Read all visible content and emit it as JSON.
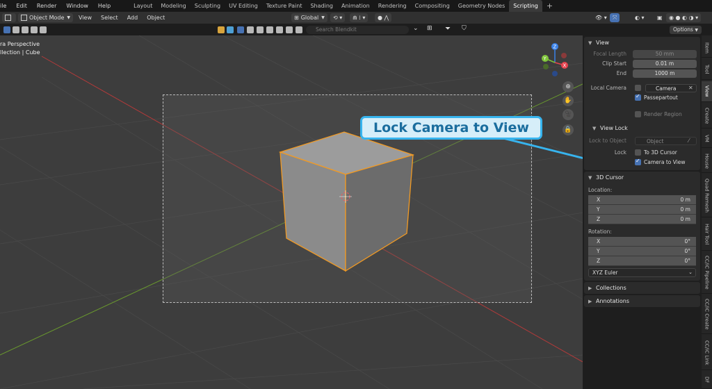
{
  "topbar": {
    "menus": [
      "ile",
      "Edit",
      "Render",
      "Window",
      "Help"
    ],
    "workspaces": [
      "Layout",
      "Modeling",
      "Sculpting",
      "UV Editing",
      "Texture Paint",
      "Shading",
      "Animation",
      "Rendering",
      "Compositing",
      "Geometry Nodes",
      "Scripting"
    ],
    "active_workspace": "Scripting",
    "add_symbol": "+"
  },
  "header": {
    "mode": "Object Mode",
    "menus": [
      "View",
      "Select",
      "Add",
      "Object"
    ],
    "transform_orientation": "Global",
    "options_label": "Options"
  },
  "toolbar": {
    "search_placeholder": "Search Blendkit"
  },
  "viewport": {
    "perspective_label": "ra Perspective",
    "collection_label": "llection | Cube",
    "gizmo": {
      "z": "Z",
      "y": "Y",
      "x": "X"
    },
    "callout_text": "Lock Camera to View"
  },
  "npanel": {
    "view_section": "View",
    "focal_length_label": "Focal Length",
    "focal_length_value": "50 mm",
    "clip_start_label": "Clip Start",
    "clip_start_value": "0.01 m",
    "end_label": "End",
    "end_value": "1000 m",
    "local_camera_label": "Local Camera",
    "local_camera_value": "Camera",
    "passepartout_label": "Passepartout",
    "render_region_label": "Render Region",
    "view_lock_section": "View Lock",
    "lock_to_object_label": "Lock to Object",
    "lock_to_object_placeholder": "Object",
    "lock_label": "Lock",
    "to_3d_cursor_label": "To 3D Cursor",
    "camera_to_view_label": "Camera to View",
    "cursor_section": "3D Cursor",
    "location_label": "Location:",
    "location": [
      {
        "axis": "X",
        "value": "0 m"
      },
      {
        "axis": "Y",
        "value": "0 m"
      },
      {
        "axis": "Z",
        "value": "0 m"
      }
    ],
    "rotation_label": "Rotation:",
    "rotation": [
      {
        "axis": "X",
        "value": "0°"
      },
      {
        "axis": "Y",
        "value": "0°"
      },
      {
        "axis": "Z",
        "value": "0°"
      }
    ],
    "rotation_mode": "XYZ Euler",
    "collections_section": "Collections",
    "annotations_section": "Annotations"
  },
  "side_tabs": [
    "Item",
    "Tool",
    "View",
    "Create",
    "VM",
    "House",
    "Quad Remesh",
    "Hair Tool",
    "CC/iC Pipeline",
    "CC/iC Create",
    "CC/iC Link",
    "DF"
  ],
  "active_side_tab": "View",
  "colors": {
    "accent_blue": "#4772b3",
    "callout_border": "#37b4ee",
    "callout_text": "#1a6d9e",
    "selection_orange": "#f19a24",
    "axis_red": "#b53a3a",
    "axis_green": "#6a9a2e",
    "gizmo_x": "#e5434f",
    "gizmo_y": "#7fc43a",
    "gizmo_z": "#3b82e8"
  }
}
